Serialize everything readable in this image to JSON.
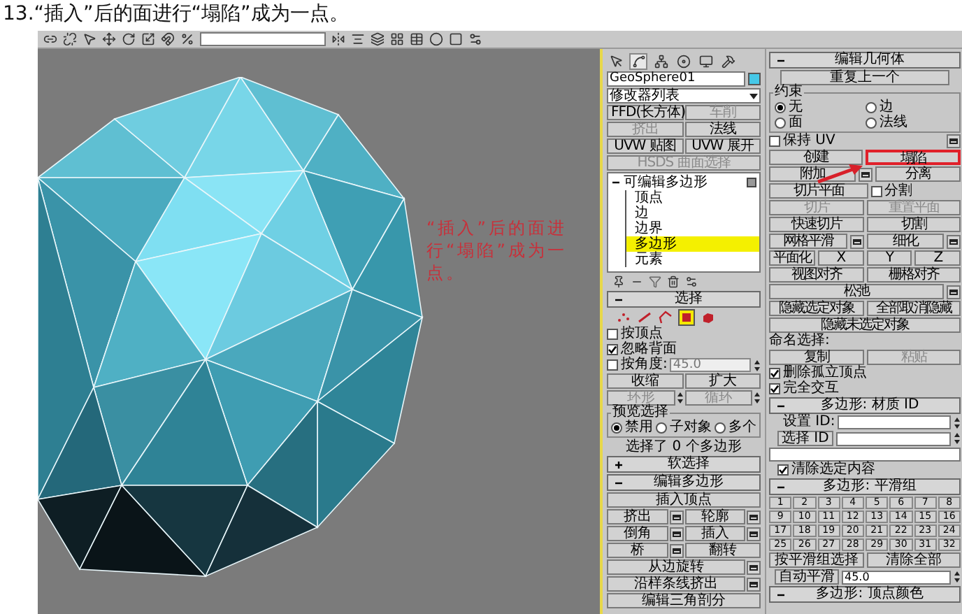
{
  "caption": "13.“插入”后的面进行“塌陷”成为一点。",
  "viewport": {
    "annotation": "“插入”后的面进行“塌陷”成为一点。"
  },
  "command_tabs": [
    {
      "kind": "create",
      "selected": false
    },
    {
      "kind": "modify",
      "selected": true
    },
    {
      "kind": "hierarchy",
      "selected": false
    },
    {
      "kind": "motion",
      "selected": false
    },
    {
      "kind": "display",
      "selected": false
    },
    {
      "kind": "utilities",
      "selected": false
    }
  ],
  "modify_panel": {
    "object_name": "GeoSphere01",
    "modifier_list": "修改器列表",
    "modifier_buttons": [
      {
        "label": "FFD(长方体)",
        "disabled": false
      },
      {
        "label": "车削",
        "disabled": true
      },
      {
        "label": "挤出",
        "disabled": true
      },
      {
        "label": "法线",
        "disabled": false
      },
      {
        "label": "UVW 贴图",
        "disabled": false
      },
      {
        "label": "UVW 展开",
        "disabled": false
      },
      {
        "label": "HSDS 曲面选择",
        "disabled": true
      }
    ],
    "stack": {
      "label": "可编辑多边形",
      "expanded": true,
      "children": [
        {
          "label": "顶点",
          "selected": false
        },
        {
          "label": "边",
          "selected": false
        },
        {
          "label": "边界",
          "selected": false
        },
        {
          "label": "多边形",
          "selected": true
        },
        {
          "label": "元素",
          "selected": false
        }
      ]
    },
    "selection": {
      "title": "选择",
      "expanded": true,
      "modes": [
        {
          "kind": "vertex",
          "selected": false
        },
        {
          "kind": "edge",
          "selected": false
        },
        {
          "kind": "border",
          "selected": false
        },
        {
          "kind": "polygon",
          "selected": true
        },
        {
          "kind": "element",
          "selected": false
        }
      ],
      "checkboxes": [
        {
          "label": "按顶点",
          "checked": false
        },
        {
          "label": "忽略背面",
          "checked": true
        }
      ],
      "by_angle": {
        "label": "按角度:",
        "checked": false,
        "value": "45.0"
      },
      "buttons": [
        {
          "label": "收缩",
          "disabled": false,
          "spinner": false
        },
        {
          "label": "扩大",
          "disabled": false,
          "spinner": false
        },
        {
          "label": "环形",
          "disabled": true,
          "spinner": true
        },
        {
          "label": "循环",
          "disabled": true,
          "spinner": true
        }
      ],
      "preview": {
        "title": "预览选择",
        "options": [
          {
            "label": "禁用",
            "selected": true
          },
          {
            "label": "子对象",
            "selected": false
          },
          {
            "label": "多个",
            "selected": false
          }
        ]
      },
      "status": "选择了 0 个多边形"
    },
    "soft_selection": {
      "title": "软选择",
      "expanded": false
    },
    "edit_polygons": {
      "title": "编辑多边形",
      "expanded": true,
      "buttons": [
        {
          "label": "插入顶点",
          "wide": true,
          "settings": false,
          "disabled": false
        },
        {
          "label": "挤出",
          "wide": false,
          "settings": true,
          "disabled": false
        },
        {
          "label": "轮廓",
          "wide": false,
          "settings": true,
          "disabled": false
        },
        {
          "label": "倒角",
          "wide": false,
          "settings": true,
          "disabled": false
        },
        {
          "label": "插入",
          "wide": false,
          "settings": true,
          "disabled": false
        },
        {
          "label": "桥",
          "wide": false,
          "settings": true,
          "disabled": false
        },
        {
          "label": "翻转",
          "wide": false,
          "settings": false,
          "disabled": false
        },
        {
          "label": "从边旋转",
          "wide": true,
          "settings": true,
          "disabled": false
        },
        {
          "label": "沿样条线挤出",
          "wide": true,
          "settings": true,
          "disabled": false
        },
        {
          "label": "编辑三角剖分",
          "wide": true,
          "settings": false,
          "disabled": false
        }
      ]
    }
  },
  "edit_geometry": {
    "title": "编辑几何体",
    "expanded": true,
    "repeat_last": "重复上一个",
    "constraints": {
      "title": "约束",
      "options": [
        {
          "label": "无",
          "selected": true
        },
        {
          "label": "边",
          "selected": false
        },
        {
          "label": "面",
          "selected": false
        },
        {
          "label": "法线",
          "selected": false
        }
      ]
    },
    "rows": [
      [
        {
          "kind": "checkbox",
          "label": "保持 UV",
          "checked": false,
          "settings": true
        }
      ],
      [
        {
          "kind": "button",
          "label": "创建",
          "disabled": false,
          "settings": false,
          "highlighted": false
        },
        {
          "kind": "button",
          "label": "塌陷",
          "disabled": false,
          "settings": false,
          "highlighted": true
        }
      ],
      [
        {
          "kind": "button",
          "label": "附加",
          "disabled": false,
          "settings": true,
          "highlighted": false
        },
        {
          "kind": "button",
          "label": "分离",
          "disabled": false,
          "settings": false,
          "highlighted": false
        }
      ],
      [
        {
          "kind": "button",
          "label": "切片平面",
          "disabled": false,
          "settings": false,
          "highlighted": false
        },
        {
          "kind": "checkbox",
          "label": "分割",
          "checked": false,
          "settings": false
        }
      ],
      [
        {
          "kind": "button",
          "label": "切片",
          "disabled": true,
          "settings": false,
          "highlighted": false
        },
        {
          "kind": "button",
          "label": "重置平面",
          "disabled": true,
          "settings": false,
          "highlighted": false
        }
      ],
      [
        {
          "kind": "button",
          "label": "快速切片",
          "disabled": false,
          "settings": false,
          "highlighted": false
        },
        {
          "kind": "button",
          "label": "切割",
          "disabled": false,
          "settings": false,
          "highlighted": false
        }
      ],
      [
        {
          "kind": "button",
          "label": "网格平滑",
          "disabled": false,
          "settings": true,
          "highlighted": false
        },
        {
          "kind": "button",
          "label": "细化",
          "disabled": false,
          "settings": true,
          "highlighted": false
        }
      ],
      [
        {
          "kind": "button",
          "label": "平面化",
          "disabled": false,
          "settings": false,
          "highlighted": false
        },
        {
          "kind": "button",
          "label": "X",
          "disabled": false,
          "settings": false,
          "highlighted": false
        },
        {
          "kind": "button",
          "label": "Y",
          "disabled": false,
          "settings": false,
          "highlighted": false
        },
        {
          "kind": "button",
          "label": "Z",
          "disabled": false,
          "settings": false,
          "highlighted": false
        }
      ],
      [
        {
          "kind": "button",
          "label": "视图对齐",
          "disabled": false,
          "settings": false,
          "highlighted": false
        },
        {
          "kind": "button",
          "label": "栅格对齐",
          "disabled": false,
          "settings": false,
          "highlighted": false
        }
      ],
      [
        {
          "kind": "button",
          "label": "松弛",
          "disabled": false,
          "settings": true,
          "highlighted": false
        }
      ],
      [
        {
          "kind": "button",
          "label": "隐藏选定对象",
          "disabled": false,
          "settings": false,
          "highlighted": false
        },
        {
          "kind": "button",
          "label": "全部取消隐藏",
          "disabled": false,
          "settings": false,
          "highlighted": false
        }
      ],
      [
        {
          "kind": "button",
          "label": "隐藏未选定对象",
          "disabled": false,
          "settings": false,
          "highlighted": false
        }
      ],
      [
        {
          "kind": "label",
          "label": "命名选择:"
        }
      ],
      [
        {
          "kind": "button",
          "label": "复制",
          "disabled": false,
          "settings": false,
          "highlighted": false
        },
        {
          "kind": "button",
          "label": "粘贴",
          "disabled": true,
          "settings": false,
          "highlighted": false
        }
      ],
      [
        {
          "kind": "checkbox",
          "label": "删除孤立顶点",
          "checked": true,
          "settings": false
        }
      ],
      [
        {
          "kind": "checkbox",
          "label": "完全交互",
          "checked": true,
          "settings": false
        }
      ]
    ]
  },
  "material_ids": {
    "title": "多边形: 材质 ID",
    "expanded": true,
    "set_id": "设置 ID:",
    "select_id": "选择 ID",
    "clear_selection": {
      "label": "清除选定内容",
      "checked": true
    }
  },
  "smoothing_groups": {
    "title": "多边形: 平滑组",
    "expanded": true,
    "groups": [
      "1",
      "2",
      "3",
      "4",
      "5",
      "6",
      "7",
      "8",
      "9",
      "10",
      "11",
      "12",
      "13",
      "14",
      "15",
      "16",
      "17",
      "18",
      "19",
      "20",
      "21",
      "22",
      "23",
      "24",
      "25",
      "26",
      "27",
      "28",
      "29",
      "30",
      "31",
      "32"
    ],
    "select_by": "按平滑组选择",
    "clear_all": "清除全部",
    "auto_smooth": "自动平滑",
    "threshold": "45.0"
  },
  "vertex_colors": {
    "title": "多边形: 顶点颜色",
    "expanded": true
  }
}
